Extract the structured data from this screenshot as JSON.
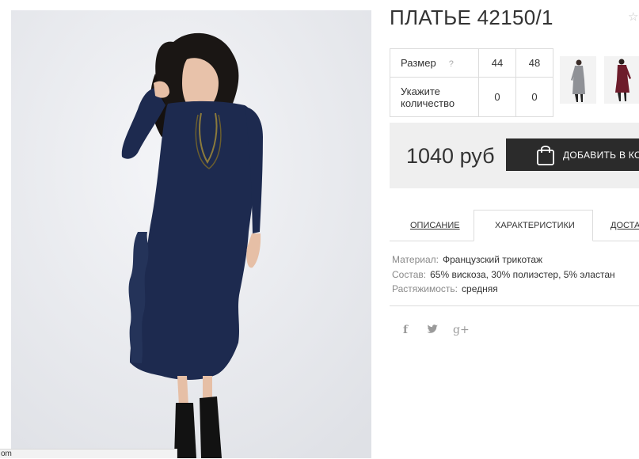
{
  "product": {
    "title": "ПЛАТЬЕ 42150/1"
  },
  "size_table": {
    "size_label": "Размер",
    "help_mark": "?",
    "sizes": [
      "44",
      "48"
    ],
    "qty_label_line1": "Укажите",
    "qty_label_line2": "количество",
    "quantities": [
      "0",
      "0"
    ]
  },
  "thumbnails": [
    {
      "icon": "grey-dress-thumbnail"
    },
    {
      "icon": "burgundy-dress-thumbnail"
    }
  ],
  "purchase": {
    "price": "1040 руб",
    "add_to_cart_label": "ДОБАВИТЬ В КОРЗИНУ"
  },
  "tabs": [
    {
      "label": "ОПИСАНИЕ",
      "active": false
    },
    {
      "label": "ХАРАКТЕРИСТИКИ",
      "active": true
    },
    {
      "label": "ДОСТАВКА",
      "active": false
    }
  ],
  "specs": [
    {
      "key": "Материал:",
      "value": "Французский трикотаж"
    },
    {
      "key": "Состав:",
      "value": "65% вискоза, 30% полиэстер, 5% эластан"
    },
    {
      "key": "Растяжимость:",
      "value": "средняя"
    }
  ],
  "social": {
    "facebook": "f",
    "twitter": "t",
    "google_plus": "g+"
  },
  "status_bar": {
    "url_fragment": "om"
  },
  "colors": {
    "dress": "#1d2a4f",
    "button_bg": "#2b2b2b",
    "price_bg": "#efefef"
  }
}
